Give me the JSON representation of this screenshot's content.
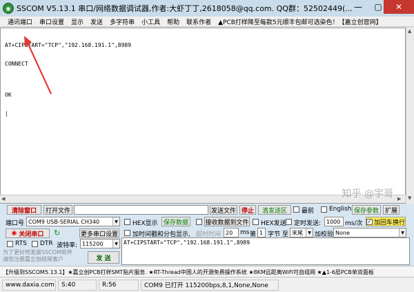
{
  "window": {
    "title": "SSCOM V5.13.1 串口/网络数据调试器,作者:大虾丁丁,2618058@qq.com. QQ群：52502449(..."
  },
  "menu": [
    "通讯端口",
    "串口设置",
    "显示",
    "发送",
    "多字符串",
    "小工具",
    "帮助",
    "联系作者",
    "▲PCB打样降至每款5元顺丰包邮可选染色！【嘉立创官网】"
  ],
  "terminal": {
    "lines": [
      "AT+CIPSTART=\"TCP\",\"192.168.191.1\",8989",
      "CONNECT",
      "",
      "OK",
      ""
    ]
  },
  "watermark": "知乎 @宇哥",
  "row1": {
    "clear_label": "清除窗口",
    "open_file_label": "打开文件",
    "send_file_label": "发送文件",
    "stop_label": "停止",
    "clear_send_label": "清发送区",
    "last_label": "最前",
    "english_label": "English",
    "save_params_label": "保存参数",
    "expand_label": "扩展"
  },
  "port": {
    "port_label": "端口号",
    "port_value": "COM9 USB-SERIAL CH340",
    "close_port_label": "关闭串口",
    "more_settings_label": "更多串口设置",
    "rts_label": "RTS",
    "dtr_label": "DTR",
    "baud_label": "波特率:",
    "baud_value": "115200"
  },
  "options": {
    "hex_display_label": "HEX显示",
    "save_data_label": "保存数据",
    "receive_to_file_label": "接收数据到文件",
    "hex_send_label": "HEX发送",
    "timed_send_label": "定时发送:",
    "timed_value": "1000",
    "timed_unit": "ms/次",
    "add_newline_label": "加回车换行",
    "timestamp_label": "加时间戳和分包显示,",
    "timeout_label": "超时时间",
    "timeout_value": "20",
    "timeout_unit": "ms",
    "byte_prefix": "第",
    "byte_value": "1",
    "byte_label": "字节 至",
    "end_value": "末尾",
    "checksum_label": "加校验",
    "checksum_value": "None"
  },
  "send": {
    "text": "AT+CIPSTART=\"TCP\",\"192.168.191.1\",8989",
    "button_label": "发 送"
  },
  "promo_text": "为了更好地发展SSCOM软件\n请您注册嘉立创结尾客户",
  "ticker": "【升级到SSCOM5.13.1】★嘉立创PCB打样SMT贴片服务. ★RT-Thread中国人的开源免费操作系统 ★8KM远距离WiFi可自组网 ★▲1-6层PCB单双面板",
  "status": {
    "website": "www.daxia.com",
    "s_count": "S:40",
    "r_count": "R:56",
    "port_state": "COM9 已打开  115200bps,8,1,None,None"
  }
}
